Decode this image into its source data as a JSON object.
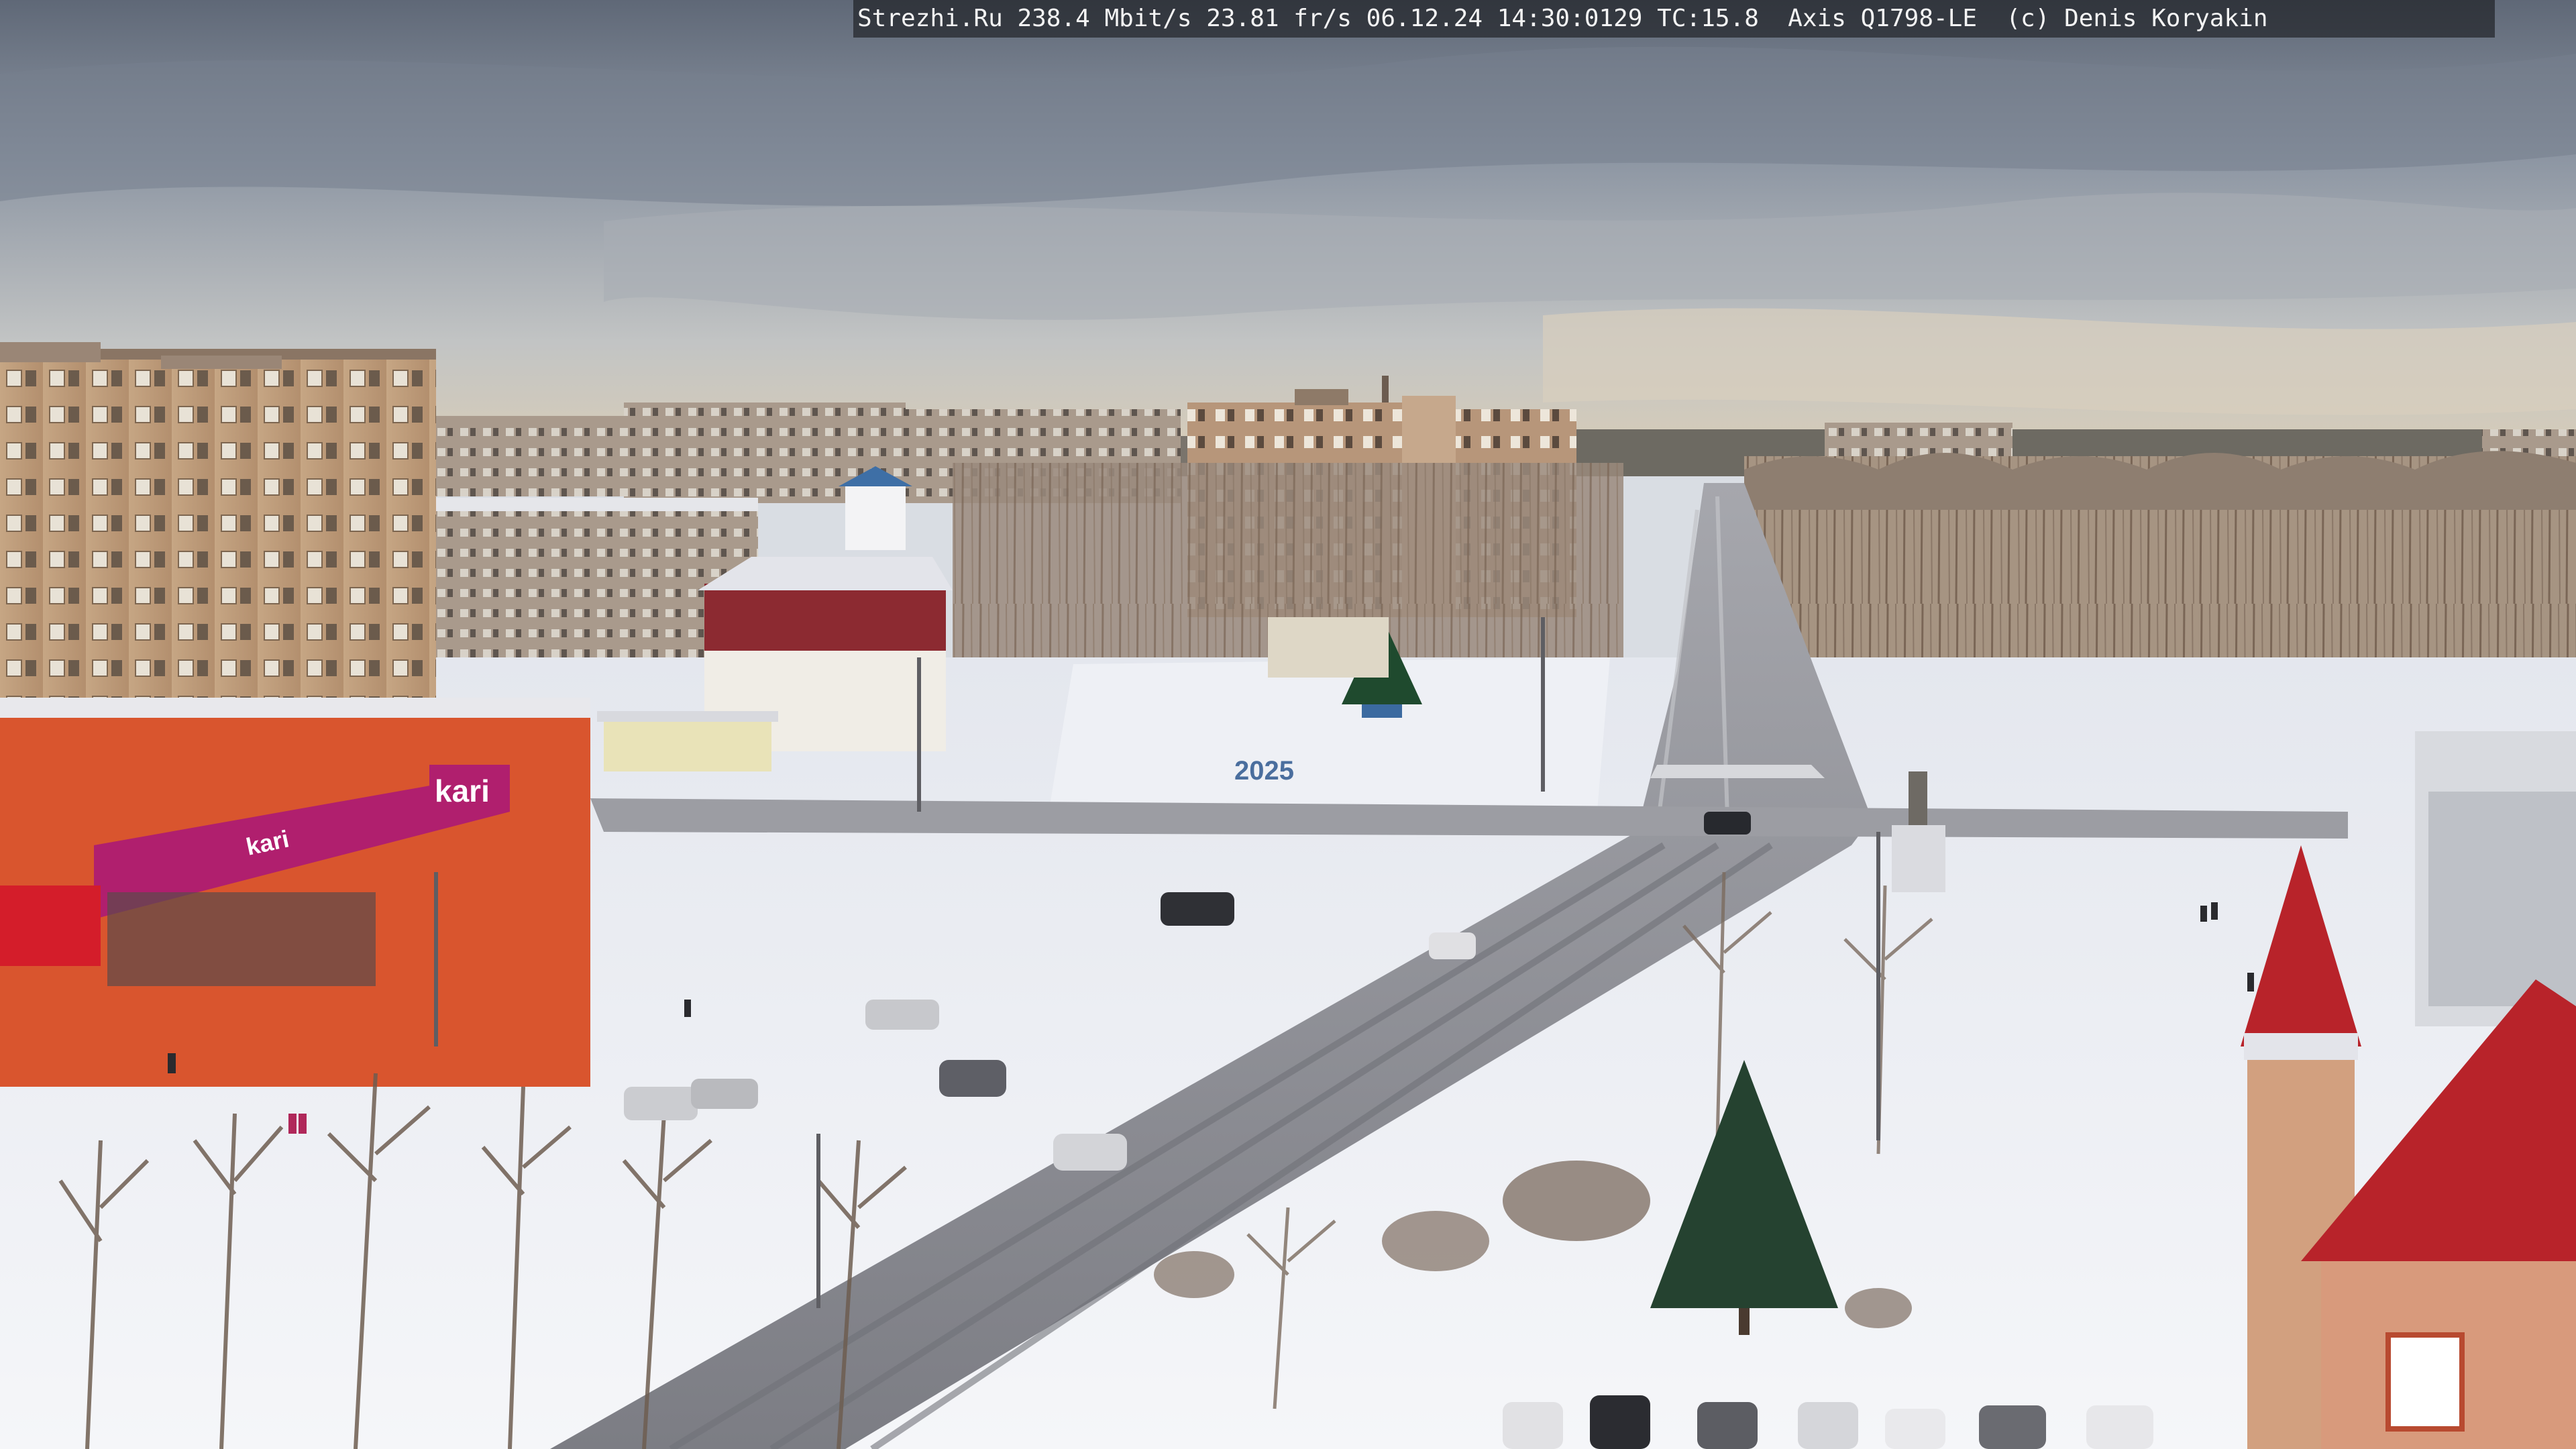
{
  "camera_overlay": {
    "site": "Strezhi.Ru",
    "bitrate": "238.4 Mbit/s",
    "framerate": "23.81 fr/s",
    "date": "06.12.24",
    "time": "14:30:0129",
    "tc": "TC:15.8",
    "camera_model": "Axis Q1798-LE",
    "copyright": "(c) Denis Koryakin"
  },
  "storefront": {
    "logo_small": "kari",
    "logo_large": "kari"
  },
  "decoration": {
    "year": "2025"
  },
  "colors": {
    "snow": "#f2f3f6",
    "road": "#8e8f95",
    "brick_orange": "#d9552e",
    "brand_magenta": "#b01f6e",
    "roof_red": "#b8232a"
  }
}
